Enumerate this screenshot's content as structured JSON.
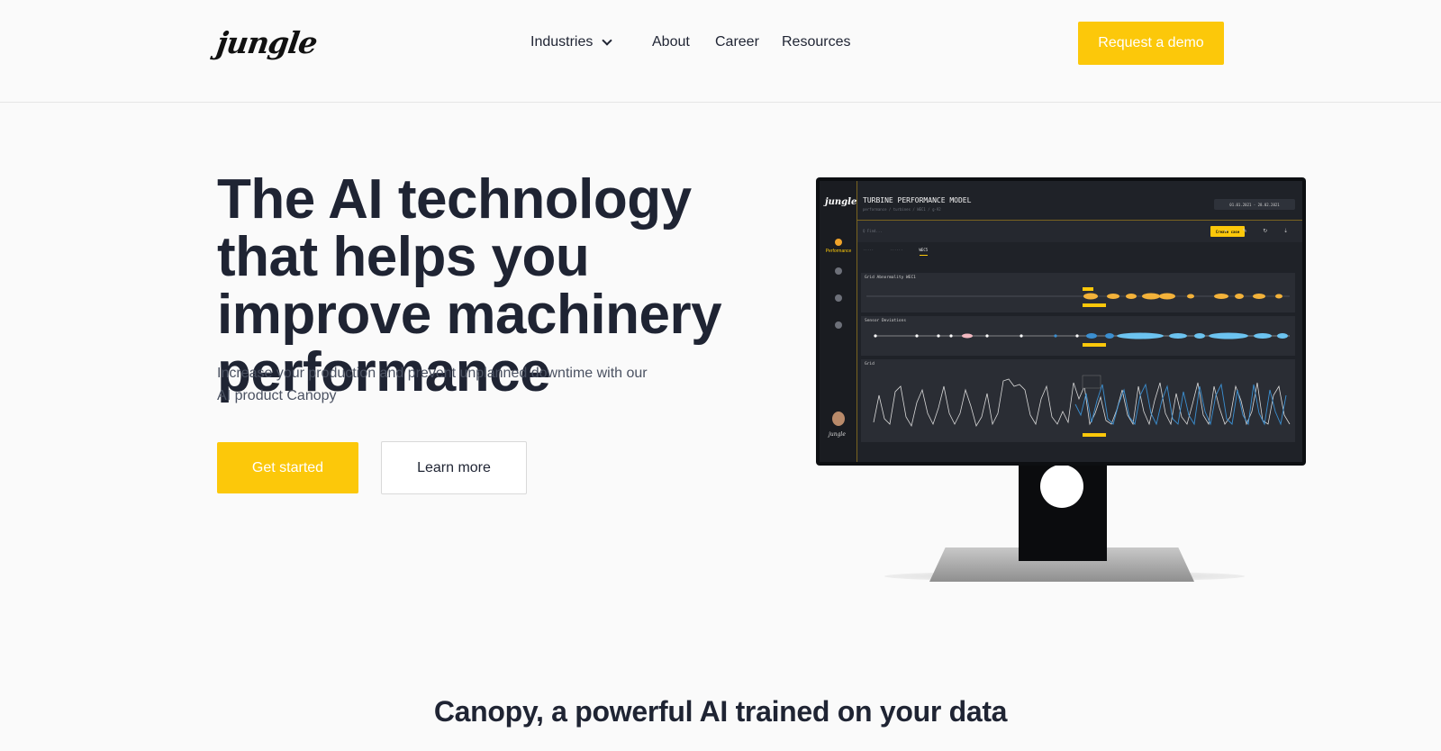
{
  "header": {
    "logo": "jungle",
    "nav": {
      "industries": "Industries",
      "about": "About",
      "career": "Career",
      "resources": "Resources"
    },
    "cta": "Request a demo"
  },
  "hero": {
    "title": "The AI technology that helps you improve machinery performance",
    "subtitle": "Increase your production and prevent unplanned downtime with our AI product Canopy",
    "primary_button": "Get started",
    "secondary_button": "Learn more"
  },
  "screen": {
    "sidebar_logo": "jungle",
    "sidebar_items": [
      "Performance",
      "",
      "",
      ""
    ],
    "sidebar_bottom": "jungle",
    "title": "TURBINE PERFORMANCE MODEL",
    "breadcrumb": "performance / turbines / WEC1 / g-92",
    "date_range": "01.01.2021 - 28.02.2021",
    "search_placeholder": "Q  Find...",
    "create_case": "Create case",
    "tabs": [
      "",
      "",
      "WEC5"
    ],
    "panels": {
      "grid_abnormality": "Grid Abnormality  WEC1",
      "sensor_deviations": "Sensor Deviations",
      "grid": "Grid"
    }
  },
  "colors": {
    "accent": "#fcc80a",
    "text_dark": "#1f2433",
    "screen_bg": "#1f2228",
    "chart_blue": "#3b8fd1",
    "chart_orange": "#f3b23a"
  },
  "section": {
    "title": "Canopy, a powerful AI trained on your data"
  }
}
